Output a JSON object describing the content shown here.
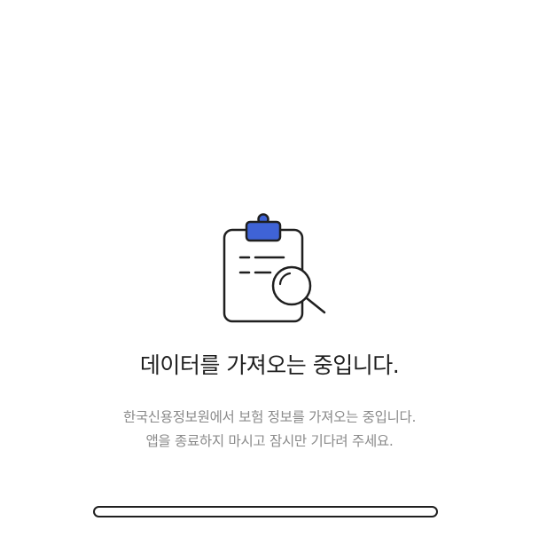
{
  "loading": {
    "title": "데이터를 가져오는 중입니다.",
    "description_line1": "한국신용정보원에서 보험 정보를 가져오는 중입니다.",
    "description_line2": "앱을 종료하지 마시고 잠시만 기다려 주세요.",
    "illustration_icon": "clipboard-search-icon",
    "progress": 0
  },
  "colors": {
    "accent": "#3f63d6",
    "text_primary": "#1f1f1f",
    "text_secondary": "#8a8a8a",
    "background": "#ffffff"
  }
}
